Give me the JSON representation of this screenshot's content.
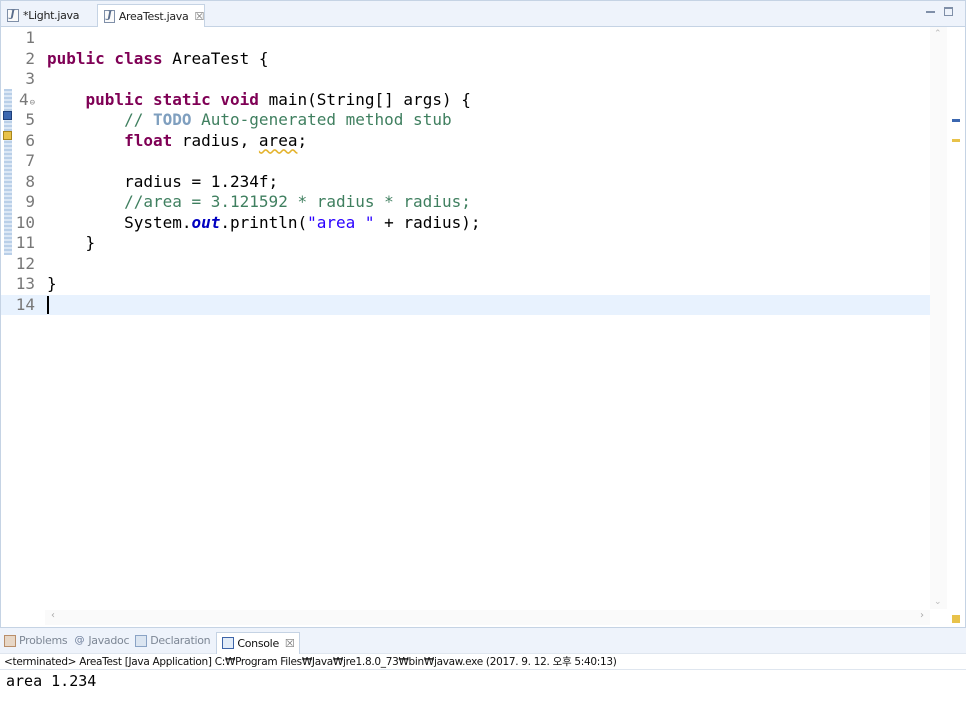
{
  "editor_tabs": {
    "light_label": "*Light.java",
    "area_label": "AreaTest.java",
    "close_glyph": "☒"
  },
  "code": {
    "line_numbers": [
      "1",
      "2",
      "3",
      "4",
      "5",
      "6",
      "7",
      "8",
      "9",
      "10",
      "11",
      "12",
      "13",
      "14"
    ],
    "l2_kw": "public class ",
    "l2_name": "AreaTest {",
    "l4_kw": "public static void ",
    "l4_rest": "main(String[] args) {",
    "l5_comment_start": "// ",
    "l5_todo": "TODO",
    "l5_comment_end": " Auto-generated method stub",
    "l6_kw": "float ",
    "l6_vars": "radius, ",
    "l6_warn_var": "area",
    "l6_end": ";",
    "l8": "radius = 1.234f;",
    "l9": "//area = 3.121592 * radius * radius;",
    "l10_system": "System.",
    "l10_out": "out",
    "l10_println": ".println(",
    "l10_str": "\"area \"",
    "l10_rest": " + radius);",
    "l11": "}",
    "l13": "}"
  },
  "console_panel": {
    "tabs": {
      "problems": "Problems",
      "javadoc": "Javadoc",
      "declaration": "Declaration",
      "console": "Console"
    },
    "close_glyph": "☒",
    "terminated_line": "<terminated> AreaTest [Java Application] C:₩Program Files₩Java₩jre1.8.0_73₩bin₩javaw.exe (2017. 9. 12. 오후 5:40:13)",
    "output": "area 1.234"
  },
  "colors": {
    "keyword": "#7f0055",
    "comment": "#3f7f5f",
    "string": "#2a00ff",
    "static_field": "#0000c0",
    "current_line": "#e8f2fe"
  }
}
